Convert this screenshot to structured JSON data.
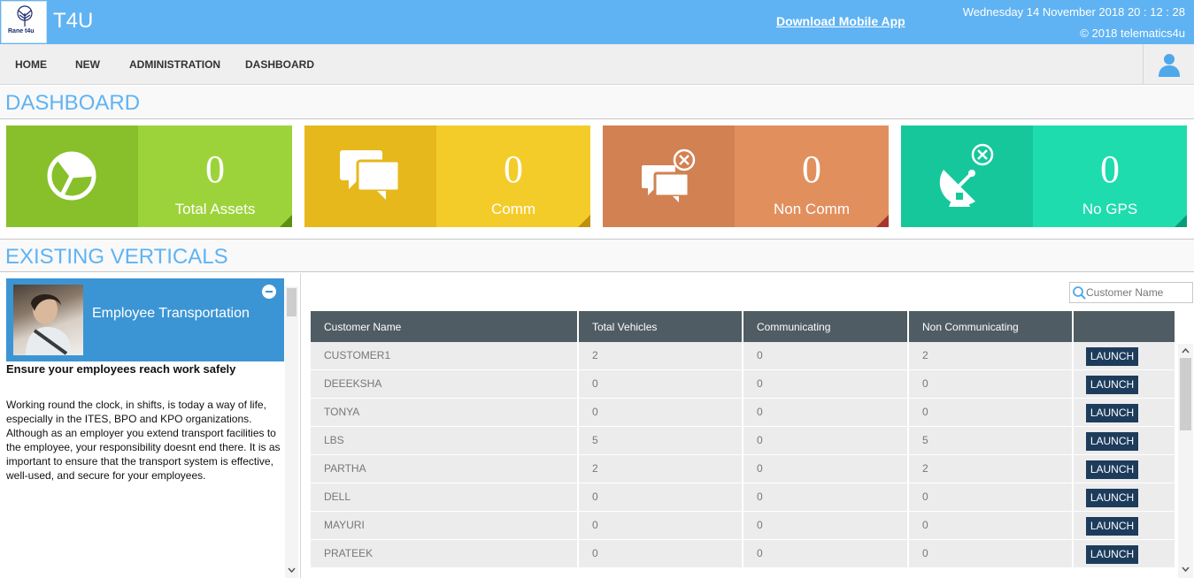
{
  "header": {
    "logo_text": "Rane t4u",
    "brand": "T4U",
    "download_link": "Download Mobile App",
    "datetime": "Wednesday 14 November 2018 20 : 12 : 28",
    "copyright": "© 2018 telematics4u"
  },
  "nav": {
    "items": [
      {
        "label": "HOME"
      },
      {
        "label": "NEW"
      },
      {
        "label": "ADMINISTRATION"
      },
      {
        "label": "DASHBOARD"
      }
    ]
  },
  "dashboard": {
    "title": "DASHBOARD",
    "tiles": [
      {
        "value": "0",
        "label": "Total Assets",
        "icon": "pie-chart-icon",
        "color_dark": "#87c02a",
        "color_light": "#9dd33a",
        "corner": "#5e8f10"
      },
      {
        "value": "0",
        "label": "Comm",
        "icon": "chat-bubbles-icon",
        "color_dark": "#e6b81c",
        "color_light": "#f4cc2a",
        "corner": "#c1900a"
      },
      {
        "value": "0",
        "label": "Non Comm",
        "icon": "chat-disconnected-icon",
        "color_dark": "#d28152",
        "color_light": "#e28f5e",
        "corner": "#a5362c"
      },
      {
        "value": "0",
        "label": "No GPS",
        "icon": "satellite-off-icon",
        "color_dark": "#16c79c",
        "color_light": "#1edcae",
        "corner": "#0c9a78"
      }
    ]
  },
  "verticals": {
    "title": "EXISTING VERTICALS",
    "card_title": "Employee Transportation",
    "heading": "Ensure your employees reach work safely",
    "description": "Working round the clock, in shifts, is today a way of life, especially in the ITES, BPO and KPO organizations. Although as an employer you extend transport facilities to the employee, your responsibility doesnt end there. It is as important to ensure that the transport system is effective, well-used, and secure for your employees."
  },
  "search": {
    "placeholder": "Customer Name"
  },
  "table": {
    "columns": [
      "Customer Name",
      "Total Vehicles",
      "Communicating",
      "Non Communicating",
      ""
    ],
    "launch_label": "LAUNCH",
    "rows": [
      {
        "name": "CUSTOMER1",
        "total": "2",
        "comm": "0",
        "noncomm": "2"
      },
      {
        "name": "DEEEKSHA",
        "total": "0",
        "comm": "0",
        "noncomm": "0"
      },
      {
        "name": "TONYA",
        "total": "0",
        "comm": "0",
        "noncomm": "0"
      },
      {
        "name": "LBS",
        "total": "5",
        "comm": "0",
        "noncomm": "5"
      },
      {
        "name": "PARTHA",
        "total": "2",
        "comm": "0",
        "noncomm": "2"
      },
      {
        "name": "DELL",
        "total": "0",
        "comm": "0",
        "noncomm": "0"
      },
      {
        "name": "MAYURI",
        "total": "0",
        "comm": "0",
        "noncomm": "0"
      },
      {
        "name": "PRATEEK",
        "total": "0",
        "comm": "0",
        "noncomm": "0"
      }
    ]
  }
}
